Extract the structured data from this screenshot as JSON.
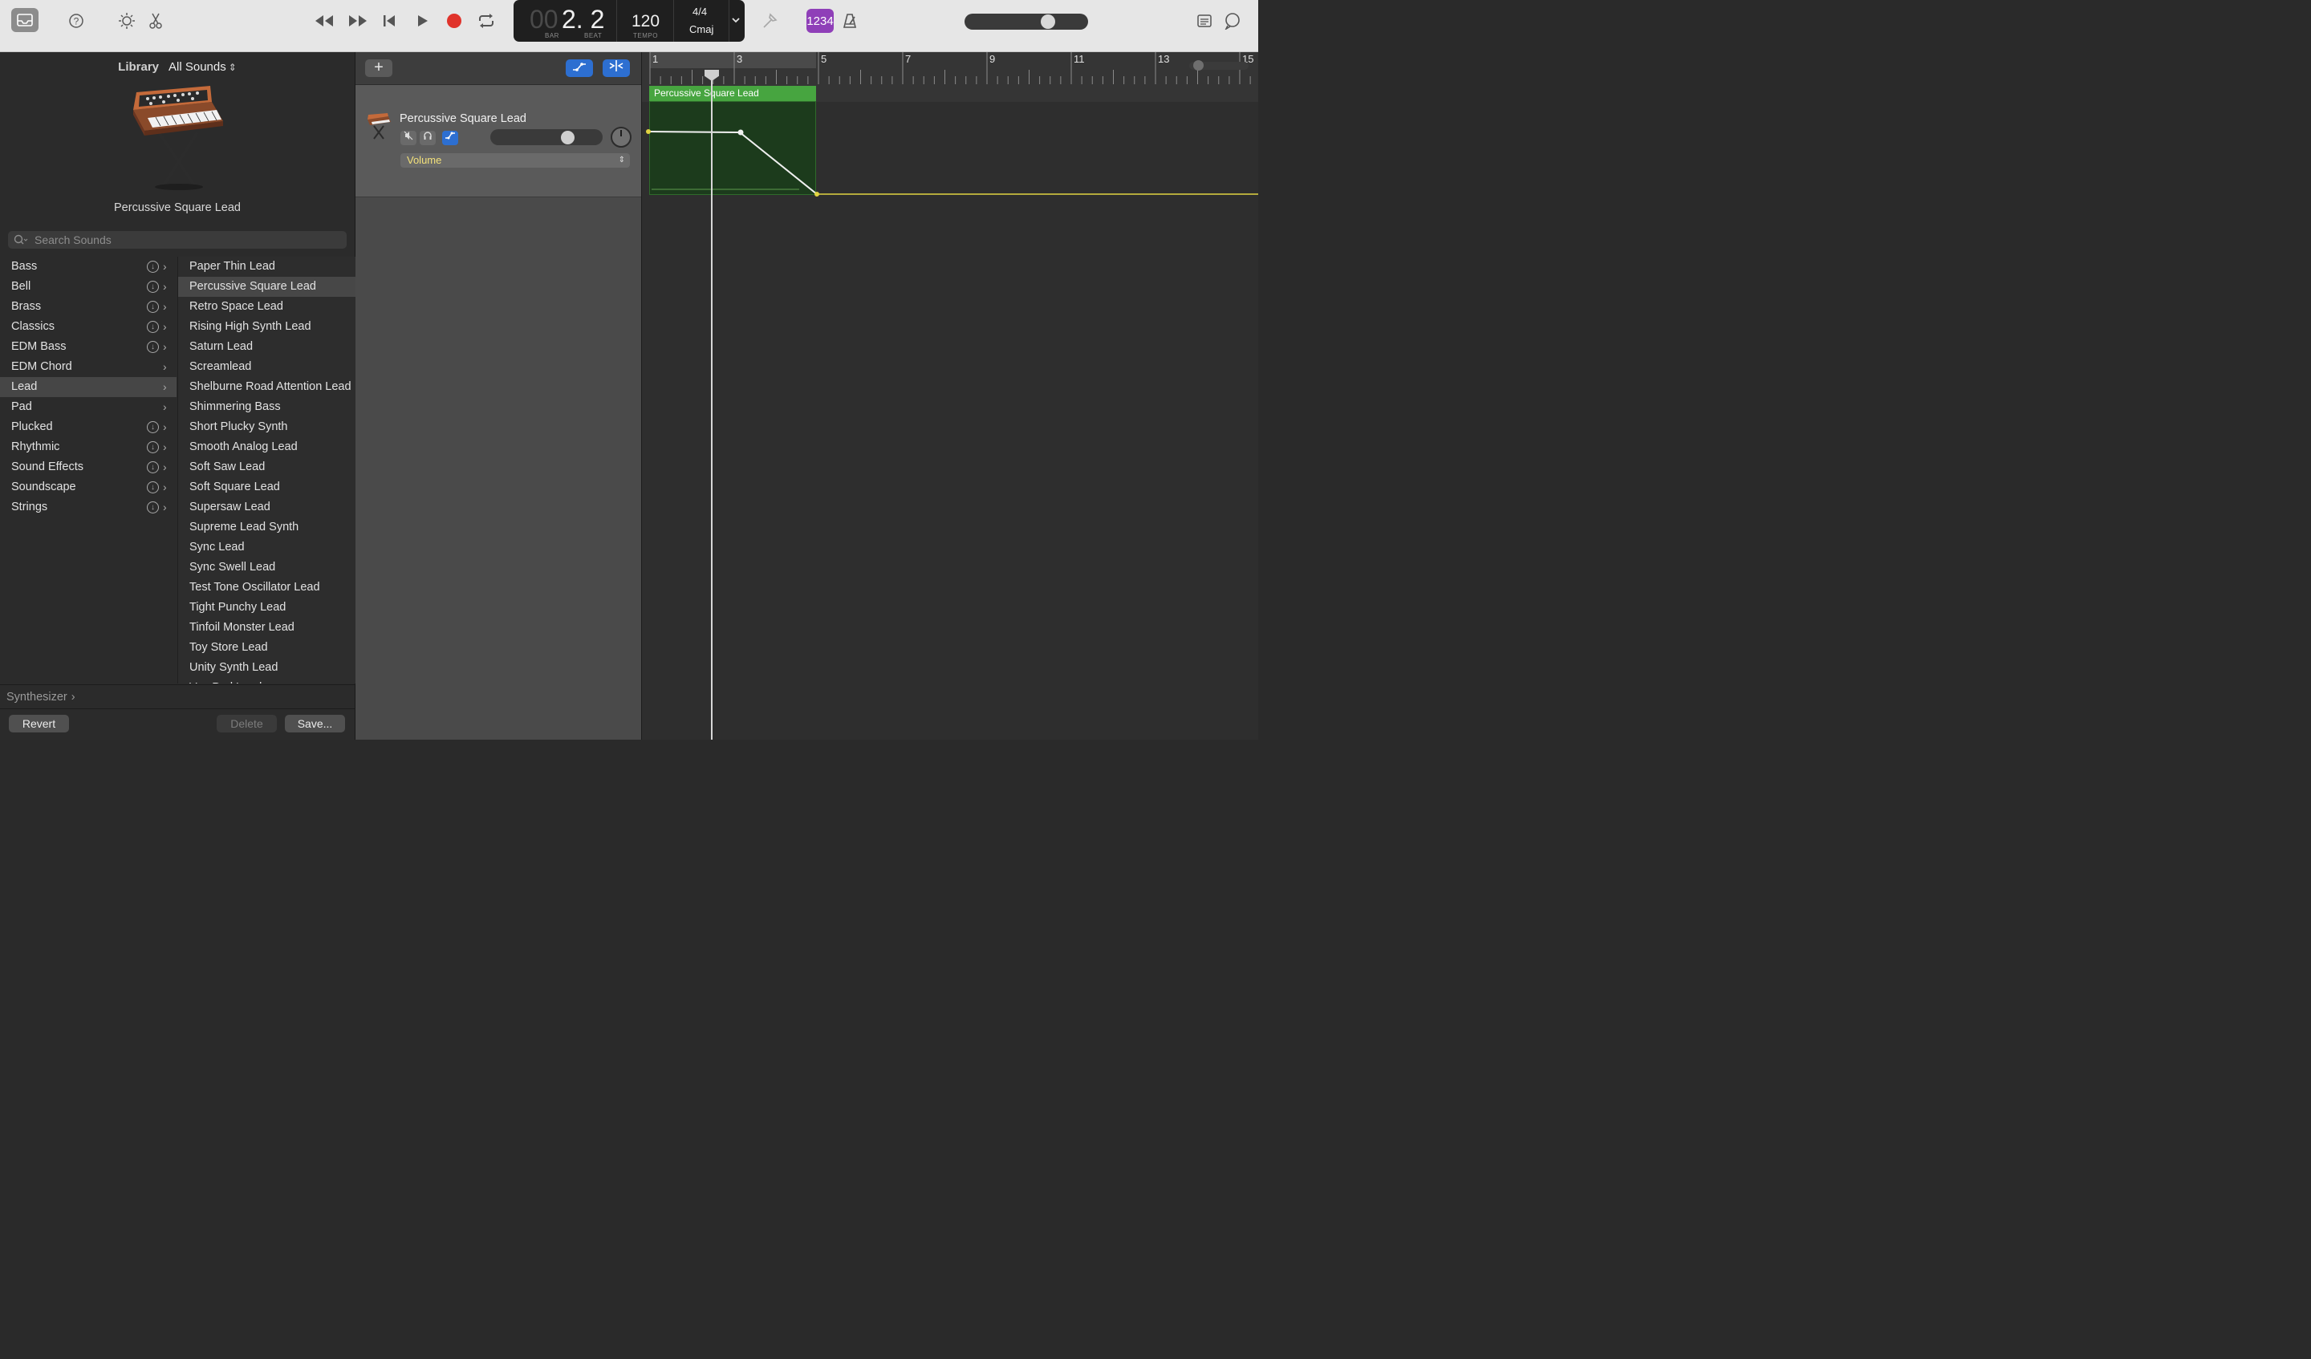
{
  "toolbar": {
    "icons": [
      "library-icon",
      "help-icon",
      "smart-controls-icon",
      "scissors-icon",
      "rewind-icon",
      "fast-forward-icon",
      "go-to-start-icon",
      "play-icon",
      "record-icon",
      "cycle-icon",
      "tuner-icon",
      "count-in-icon",
      "metronome-icon",
      "notepad-icon",
      "loops-icon"
    ],
    "lcd": {
      "bar_prefix": "00",
      "position": "2. 2",
      "bar_label": "BAR",
      "beat_label": "BEAT",
      "tempo": "120",
      "tempo_label": "TEMPO",
      "time_signature": "4/4",
      "key": "Cmaj"
    },
    "count_in_label": "1234",
    "record_color": "#e0332b",
    "count_in_color": "#8f3fb8"
  },
  "library": {
    "title": "Library",
    "filter": "All Sounds",
    "instrument_name": "Percussive Square Lead",
    "search_placeholder": "Search Sounds",
    "categories": [
      {
        "label": "Bass",
        "download": true
      },
      {
        "label": "Bell",
        "download": true
      },
      {
        "label": "Brass",
        "download": true
      },
      {
        "label": "Classics",
        "download": true
      },
      {
        "label": "EDM Bass",
        "download": true
      },
      {
        "label": "EDM Chord",
        "download": false
      },
      {
        "label": "Lead",
        "download": false,
        "selected": true
      },
      {
        "label": "Pad",
        "download": false
      },
      {
        "label": "Plucked",
        "download": true
      },
      {
        "label": "Rhythmic",
        "download": true
      },
      {
        "label": "Sound Effects",
        "download": true
      },
      {
        "label": "Soundscape",
        "download": true
      },
      {
        "label": "Strings",
        "download": true
      }
    ],
    "patches": [
      "Paper Thin Lead",
      "Percussive Square Lead",
      "Retro Space Lead",
      "Rising High Synth Lead",
      "Saturn Lead",
      "Screamlead",
      "Shelburne Road Attention Lead",
      "Shimmering Bass",
      "Short Plucky Synth",
      "Smooth Analog Lead",
      "Soft Saw Lead",
      "Soft Square Lead",
      "Supersaw Lead",
      "Supreme Lead Synth",
      "Sync Lead",
      "Sync Swell Lead",
      "Test Tone Oscillator Lead",
      "Tight Punchy Lead",
      "Tinfoil Monster Lead",
      "Toy Store Lead",
      "Unity Synth Lead",
      "Vox Pad Lead"
    ],
    "selected_patch": "Percussive Square Lead",
    "path": "Synthesizer",
    "revert_label": "Revert",
    "delete_label": "Delete",
    "save_label": "Save..."
  },
  "track": {
    "name": "Percussive Square Lead",
    "automation_param": "Volume",
    "volume_fraction": 0.63
  },
  "timeline": {
    "bar_numbers": [
      "1",
      "3",
      "5",
      "7",
      "9",
      "11",
      "13",
      "15"
    ],
    "region_name": "Percussive Square Lead",
    "region_color": "#47a540",
    "automation_color": "#e1d341"
  }
}
